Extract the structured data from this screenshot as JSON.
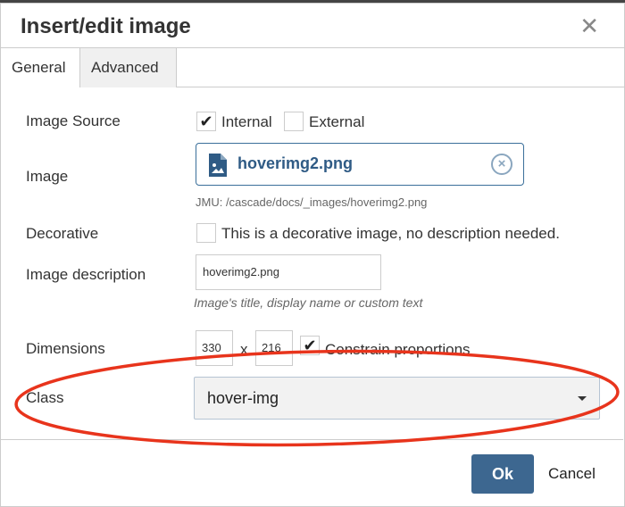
{
  "dialog": {
    "title": "Insert/edit image",
    "close_icon": "close-icon"
  },
  "tabs": [
    {
      "label": "General",
      "active": true
    },
    {
      "label": "Advanced",
      "active": false
    }
  ],
  "form": {
    "image_source": {
      "label": "Image Source",
      "options": [
        {
          "label": "Internal",
          "checked": true
        },
        {
          "label": "External",
          "checked": false
        }
      ]
    },
    "image": {
      "label": "Image",
      "value": "hoverimg2.png",
      "path": "JMU: /cascade/docs/_images/hoverimg2.png",
      "icon": "image-file-icon"
    },
    "decorative": {
      "label": "Decorative",
      "checkbox_label": "This is a decorative image, no description needed.",
      "checked": false
    },
    "description": {
      "label": "Image description",
      "value": "hoverimg2.png",
      "hint": "Image's title, display name or custom text"
    },
    "dimensions": {
      "label": "Dimensions",
      "width": "330",
      "separator": "x",
      "height": "216",
      "constrain_label": "Constrain proportions",
      "constrain_checked": true
    },
    "class": {
      "label": "Class",
      "value": "hover-img"
    }
  },
  "footer": {
    "ok": "Ok",
    "cancel": "Cancel"
  },
  "colors": {
    "primary": "#3d6790",
    "annotation": "#e8341c"
  }
}
